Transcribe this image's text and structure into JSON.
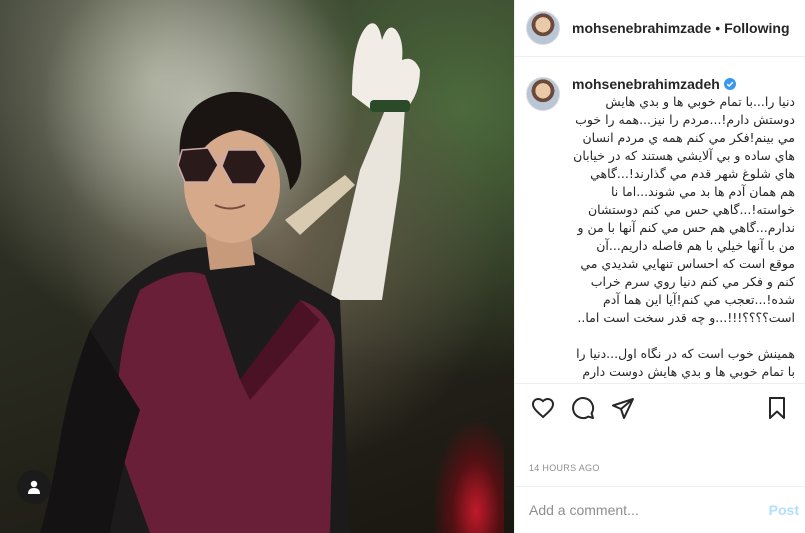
{
  "post": {
    "username": "mohsenebrahimzadeh",
    "header_username": "mohsenebrahimzade",
    "separator": "•",
    "follow_status": "Following",
    "timestamp": "14 HOURS AGO"
  },
  "caption": {
    "paragraph1": "دنيا را...با تمام خوبي ها و بدي هايش دوستش دارم!...مردم را نيز...همه را خوب مي بينم!فكر مي كنم همه ي مردم انسان هاي ساده و بي آلايشي هستند كه در خيابان هاي شلوغ شهر قدم مي گذارند!...گاهي هم همان آدم ها بد مي شوند...اما نا خواسته!...گاهي حس مي كنم دوستشان ندارم...گاهي هم حس مي كنم آنها با من و من با آنها خيلي با هم فاصله داريم...آن موقع است كه احساس تنهايي شديدي مي كنم و فكر مي كنم دنيا روي سرم خراب شده!...تعجب مي كنم!آيا اين هما آدم است؟؟؟؟!!!...و چه قدر سخت است اما..",
    "paragraph2": "همينش خوب است كه در نگاه اول...دنيا را با تمام خوبي ها و بدي هايش دوست دارم"
  },
  "comment_box": {
    "placeholder": "Add a comment...",
    "post_label": "Post"
  },
  "icons": {
    "like": "heart-icon",
    "comment": "comment-icon",
    "share": "share-icon",
    "save": "bookmark-icon",
    "tagged_users": "user-icon",
    "verified": "verified-badge-icon"
  },
  "colors": {
    "verified": "#3897f0",
    "post_button_disabled": "#b2dffc",
    "muted_text": "#8e8e8e"
  }
}
